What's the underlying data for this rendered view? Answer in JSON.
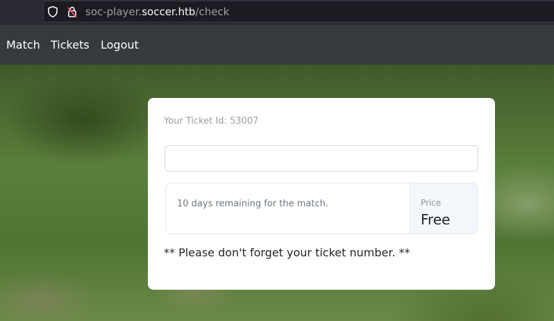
{
  "browser": {
    "url_prefix": "soc-player.",
    "url_host": "soccer.htb",
    "url_path": "/check"
  },
  "nav": {
    "items": [
      {
        "label": "Match"
      },
      {
        "label": "Tickets"
      },
      {
        "label": "Logout"
      }
    ]
  },
  "card": {
    "ticket_id_text": "Your Ticket Id: 53007",
    "ticket_input": {
      "value": "",
      "placeholder": ""
    },
    "remaining_text": "10 days remaining for the match.",
    "price_label": "Price",
    "price_value": "Free",
    "reminder_text": "** Please don't forget your ticket number. **"
  },
  "icons": {
    "tracking": "shield-icon",
    "security": "lock-icon"
  }
}
